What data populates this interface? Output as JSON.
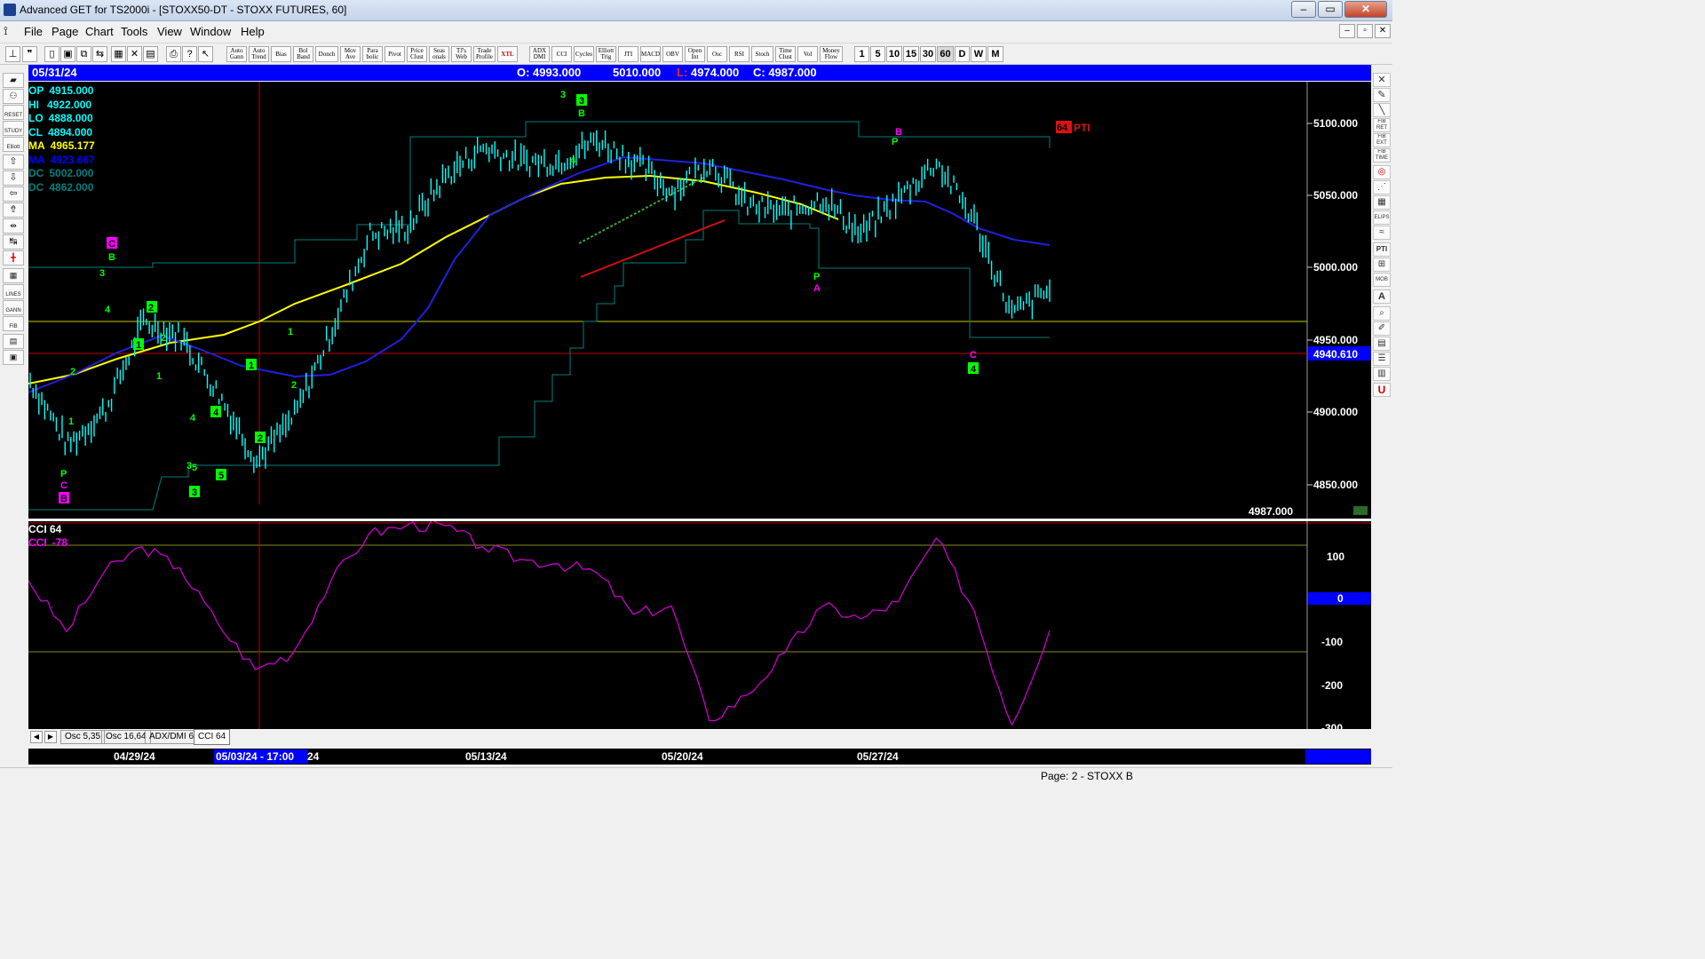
{
  "window": {
    "title": "Advanced GET for TS2000i - [STOXX50-DT - STOXX FUTURES, 60]"
  },
  "menu": {
    "items": [
      "File",
      "Page",
      "Chart",
      "Tools",
      "View",
      "Window",
      "Help"
    ]
  },
  "toolbar": {
    "study_buttons": [
      "Auto Gann",
      "Auto Trend",
      "Bias",
      "Bol Band",
      "Donch",
      "Mov Ave",
      "Para bolic",
      "Pivot",
      "Price Clust",
      "Seas onals",
      "TJ's Web",
      "Trade Profile",
      "XTL"
    ],
    "indicator_buttons": [
      "ADX DMI",
      "CCI",
      "Cycles",
      "Elliott Trig",
      "JTI",
      "MACD",
      "OBV",
      "Open Int",
      "Osc",
      "RSI",
      "Stoch",
      "Time Clust",
      "Vol",
      "Money Flow"
    ],
    "timeframes": [
      "1",
      "5",
      "10",
      "15",
      "30",
      "60",
      "D",
      "W",
      "M"
    ]
  },
  "left_tools": [
    "RESET",
    "STUDY",
    "Elliott",
    "",
    "",
    "",
    "",
    "",
    "",
    "",
    "LINES",
    "GANN",
    "FIB",
    ""
  ],
  "right_tools": [
    "",
    "",
    "FIB RET",
    "FIB EXT",
    "FIB TIME",
    "",
    "",
    "",
    "ELIPS",
    "",
    "PTI",
    "",
    "MOB",
    "A",
    "",
    "",
    "",
    "",
    "",
    "U"
  ],
  "infobar": {
    "date": "05/31/24",
    "open": "O: 4993.000",
    "high": "5010.000",
    "low_label": "L:",
    "low": "4974.000",
    "close": "C: 4987.000"
  },
  "readout": [
    {
      "label": "OP",
      "value": "4915.000",
      "color": "#00ffff"
    },
    {
      "label": "HI",
      "value": "4922.000",
      "color": "#00ffff"
    },
    {
      "label": "LO",
      "value": "4888.000",
      "color": "#00ffff"
    },
    {
      "label": "CL",
      "value": "4894.000",
      "color": "#00ffff"
    },
    {
      "label": "MA",
      "value": "4965.177",
      "color": "#ffff00"
    },
    {
      "label": "MA",
      "value": "4923.667",
      "color": "#0000ff"
    },
    {
      "label": "DC",
      "value": "5002.000",
      "color": "#008080"
    },
    {
      "label": "DC",
      "value": "4862.000",
      "color": "#008080"
    }
  ],
  "price_axis": {
    "ticks": [
      "5100.000",
      "5050.000",
      "5000.000",
      "4950.000",
      "4900.000",
      "4850.000"
    ],
    "hline_label": "4940.610",
    "last_label": "4987.000"
  },
  "pti": {
    "value": "64",
    "label": "PTI"
  },
  "elliott_labels": [
    "1",
    "2",
    "3",
    "4",
    "5",
    "A",
    "B",
    "C",
    "P"
  ],
  "oscillator": {
    "name": "CCI 64",
    "label": "CCI",
    "value": "-78",
    "ticks": [
      "100",
      "0",
      "-100",
      "-200",
      "-300"
    ]
  },
  "tabs": [
    "Osc 5,35",
    "Osc 16,64",
    "ADX/DMI 64",
    "CCI 64"
  ],
  "dates": {
    "labels": [
      "04/29/24",
      "05/13/24",
      "05/20/24",
      "05/27/24"
    ],
    "cursor": "05/03/24 - 17:00",
    "cursor_tail": "24"
  },
  "status": {
    "page": "Page: 2 - STOXX B"
  },
  "colors": {
    "background": "#000000",
    "bars": "#00ffff",
    "ma_fast": "#ffff00",
    "ma_slow": "#0000ff",
    "donchian": "#008080",
    "cci": "#cc00cc",
    "wave_green": "#00ff00",
    "wave_magenta": "#ff00ff"
  },
  "chart_data": {
    "type": "line",
    "title": "",
    "price_series": [
      {
        "x": "04/24",
        "y": 4925
      },
      {
        "x": "04/25",
        "y": 4880
      },
      {
        "x": "04/26",
        "y": 4905
      },
      {
        "x": "04/29",
        "y": 4965
      },
      {
        "x": "04/30",
        "y": 4955
      },
      {
        "x": "05/01",
        "y": 4915
      },
      {
        "x": "05/02",
        "y": 4870
      },
      {
        "x": "05/03",
        "y": 4900
      },
      {
        "x": "05/06",
        "y": 4960
      },
      {
        "x": "05/07",
        "y": 5025
      },
      {
        "x": "05/08",
        "y": 5030
      },
      {
        "x": "05/09",
        "y": 5065
      },
      {
        "x": "05/10",
        "y": 5085
      },
      {
        "x": "05/13",
        "y": 5075
      },
      {
        "x": "05/14",
        "y": 5075
      },
      {
        "x": "05/15",
        "y": 5090
      },
      {
        "x": "05/16",
        "y": 5075
      },
      {
        "x": "05/17",
        "y": 5055
      },
      {
        "x": "05/20",
        "y": 5075
      },
      {
        "x": "05/21",
        "y": 5045
      },
      {
        "x": "05/22",
        "y": 5040
      },
      {
        "x": "05/23",
        "y": 5050
      },
      {
        "x": "05/24",
        "y": 5025
      },
      {
        "x": "05/27",
        "y": 5050
      },
      {
        "x": "05/28",
        "y": 5075
      },
      {
        "x": "05/29",
        "y": 5035
      },
      {
        "x": "05/30",
        "y": 4970
      },
      {
        "x": "05/31",
        "y": 4987
      }
    ],
    "cci_series": [
      {
        "x": "04/24",
        "y": 40
      },
      {
        "x": "04/25",
        "y": -80
      },
      {
        "x": "04/26",
        "y": 60
      },
      {
        "x": "04/29",
        "y": 120
      },
      {
        "x": "04/30",
        "y": 70
      },
      {
        "x": "05/01",
        "y": -60
      },
      {
        "x": "05/02",
        "y": -170
      },
      {
        "x": "05/03",
        "y": -130
      },
      {
        "x": "05/06",
        "y": 40
      },
      {
        "x": "05/07",
        "y": 150
      },
      {
        "x": "05/08",
        "y": 170
      },
      {
        "x": "05/09",
        "y": 170
      },
      {
        "x": "05/10",
        "y": 120
      },
      {
        "x": "05/13",
        "y": 90
      },
      {
        "x": "05/14",
        "y": 80
      },
      {
        "x": "05/15",
        "y": 60
      },
      {
        "x": "05/16",
        "y": -40
      },
      {
        "x": "05/17",
        "y": -20
      },
      {
        "x": "05/20",
        "y": -290
      },
      {
        "x": "05/21",
        "y": -230
      },
      {
        "x": "05/22",
        "y": -130
      },
      {
        "x": "05/23",
        "y": -20
      },
      {
        "x": "05/24",
        "y": -50
      },
      {
        "x": "05/27",
        "y": -10
      },
      {
        "x": "05/28",
        "y": 140
      },
      {
        "x": "05/29",
        "y": -30
      },
      {
        "x": "05/30",
        "y": -300
      },
      {
        "x": "05/31",
        "y": -78
      }
    ],
    "ylim": [
      4830,
      5130
    ],
    "cci_ylim": [
      -310,
      180
    ]
  }
}
